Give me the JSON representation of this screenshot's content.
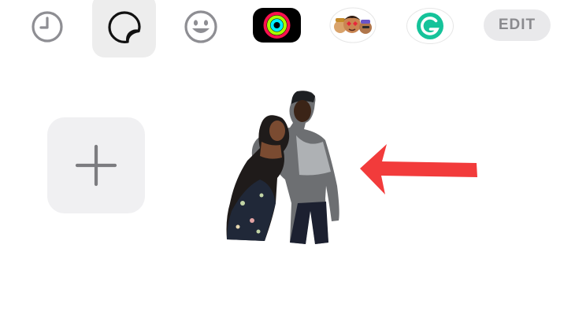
{
  "tabbar": {
    "tabs": [
      {
        "id": "recents",
        "icon": "clock-icon"
      },
      {
        "id": "stickers",
        "icon": "sticker-peel-icon",
        "selected": true
      },
      {
        "id": "emoji",
        "icon": "smiley-icon"
      },
      {
        "id": "activity",
        "icon": "activity-rings-icon"
      },
      {
        "id": "memoji",
        "icon": "memoji-icon"
      },
      {
        "id": "grammarly",
        "icon": "grammarly-icon"
      }
    ],
    "edit_label": "EDIT"
  },
  "content": {
    "add_tile_icon": "plus-icon",
    "sticker_icon": "couple-photo-sticker",
    "annotation_icon": "red-arrow-left-icon"
  },
  "colors": {
    "accent_red": "#f23b3b",
    "selected_tab_bg": "#ededed",
    "grammarly_green": "#15c39a",
    "activity_move": "#fa114f",
    "activity_exercise": "#a6ff00",
    "activity_stand": "#00f0ff"
  }
}
